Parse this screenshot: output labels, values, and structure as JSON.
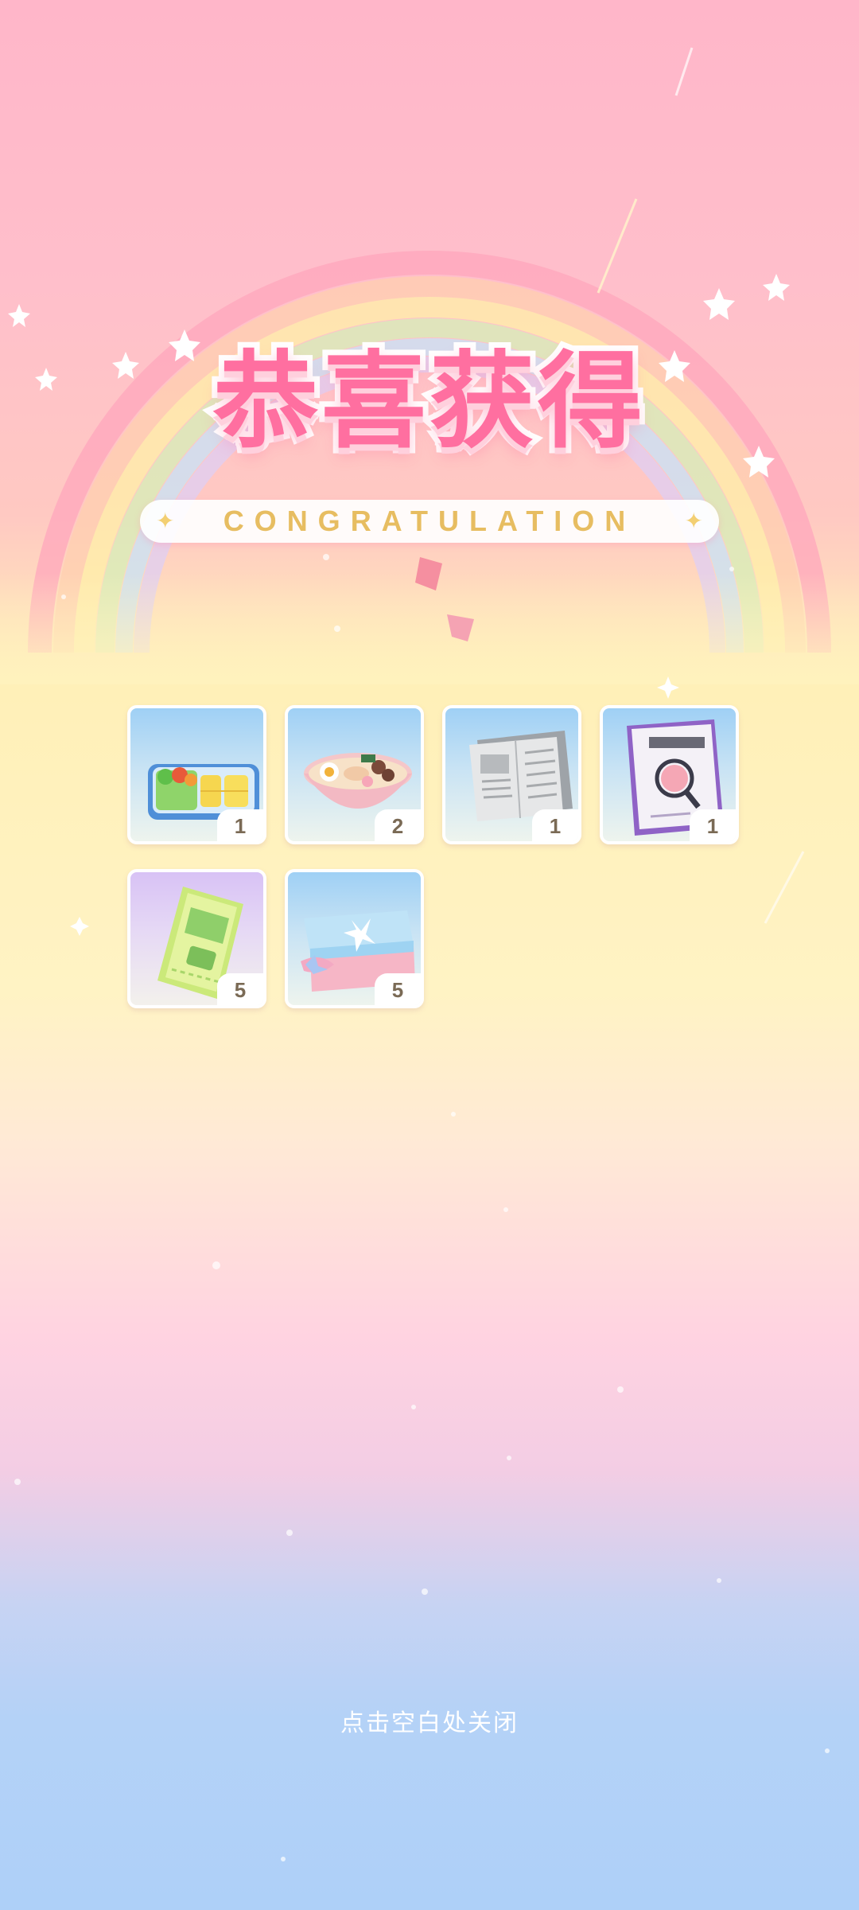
{
  "title": "恭喜获得",
  "subtitle": "CONGRATULATION",
  "rewards": [
    {
      "name": "bento-box-icon",
      "count": "1"
    },
    {
      "name": "ramen-bowl-icon",
      "count": "2"
    },
    {
      "name": "newspaper-icon",
      "count": "1"
    },
    {
      "name": "magnifier-book-icon",
      "count": "1"
    },
    {
      "name": "green-ticket-icon",
      "count": "5"
    },
    {
      "name": "gift-box-icon",
      "count": "5"
    }
  ],
  "close_hint": "点击空白处关闭",
  "colors": {
    "title_pink": "#ff6fa0",
    "subtitle_gold": "#e7bd61",
    "count_text": "#7a6a55"
  }
}
